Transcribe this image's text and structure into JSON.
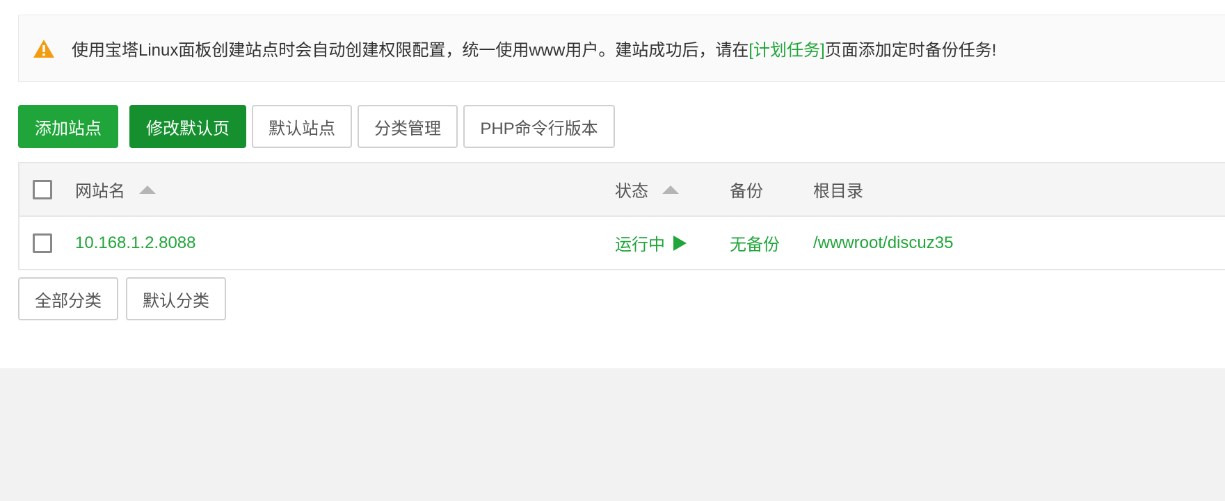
{
  "notice": {
    "icon": "warning-triangle-icon",
    "text_before": "使用宝塔Linux面板创建站点时会自动创建权限配置，统一使用www用户。建站成功后，请在",
    "link_text": "[计划任务]",
    "text_after": "页面添加定时备份任务!"
  },
  "toolbar": {
    "add_site": "添加站点",
    "edit_default_page": "修改默认页",
    "default_site": "默认站点",
    "category_manage": "分类管理",
    "php_cli_version": "PHP命令行版本"
  },
  "table": {
    "headers": {
      "site_name": "网站名",
      "status": "状态",
      "backup": "备份",
      "root_dir": "根目录"
    },
    "rows": [
      {
        "site_name": "10.168.1.2.8088",
        "status": "运行中",
        "backup": "无备份",
        "root_dir": "/wwwroot/discuz35"
      }
    ]
  },
  "categories": {
    "all": "全部分类",
    "default": "默认分类"
  },
  "colors": {
    "accent_green": "#20a53a",
    "dark_green": "#168f2f",
    "warning_orange": "#f39c12"
  }
}
